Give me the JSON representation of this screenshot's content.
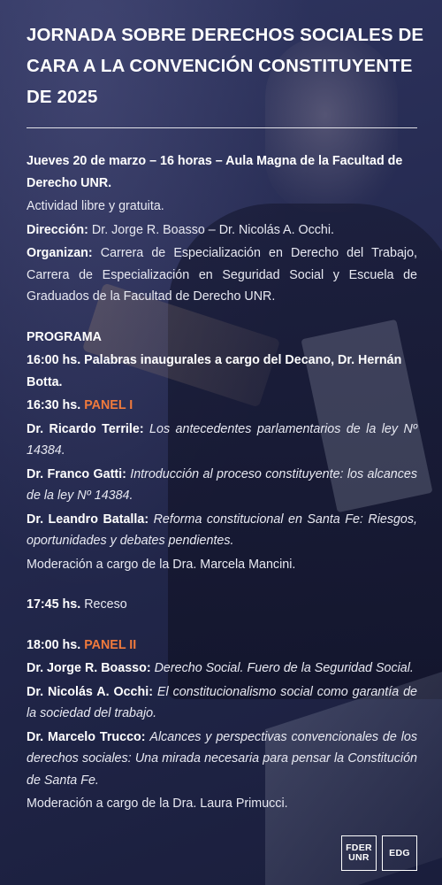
{
  "title": "JORNADA SOBRE DERECHOS SOCIALES DE CARA A LA CONVENCIÓN CONSTITUYENTE DE 2025",
  "header": {
    "when": "Jueves 20 de marzo – 16 horas – Aula Magna de la Facultad de Derecho UNR.",
    "free": "Actividad libre y gratuita.",
    "direction_label": "Dirección:",
    "direction": "Dr. Jorge R. Boasso – Dr. Nicolás A. Occhi.",
    "organizers_label": "Organizan:",
    "organizers": "Carrera de Especialización en Derecho del Trabajo, Carrera de Especialización en Seguridad Social y Escuela de Graduados de la Facultad de Derecho UNR."
  },
  "program": {
    "heading": "PROGRAMA",
    "opening": "16:00 hs. Palabras inaugurales a cargo del Decano, Dr. Hernán Botta.",
    "panel1": {
      "time": "16:30 hs.",
      "name": "PANEL I",
      "talks": [
        {
          "speaker": "Dr. Ricardo Terrile:",
          "topic": "Los antecedentes parlamentarios de la ley Nº 14384."
        },
        {
          "speaker": "Dr. Franco Gatti:",
          "topic": "Introducción al proceso constituyente: los alcances de la ley Nº 14384."
        },
        {
          "speaker": "Dr. Leandro Batalla:",
          "topic": "Reforma constitucional en Santa Fe: Riesgos, oportunidades y debates pendientes."
        }
      ],
      "moderation": "Moderación a cargo de la Dra. Marcela Mancini."
    },
    "break": {
      "time": "17:45 hs.",
      "label": "Receso"
    },
    "panel2": {
      "time": "18:00 hs.",
      "name": "PANEL II",
      "talks": [
        {
          "speaker": "Dr. Jorge R. Boasso:",
          "topic": "Derecho Social. Fuero de la Seguridad Social."
        },
        {
          "speaker": "Dr. Nicolás A. Occhi:",
          "topic": "El constitucionalismo social como garantía de la sociedad del trabajo."
        },
        {
          "speaker": "Dr. Marcelo Trucco:",
          "topic": "Alcances y perspectivas convencionales de los derechos sociales: Una mirada necesaria para pensar la Constitución de Santa Fe."
        }
      ],
      "moderation": "Moderación a cargo de la Dra. Laura Primucci."
    }
  },
  "logos": {
    "fder_line1": "FDER",
    "fder_line2": "UNR",
    "edg": "EDG"
  },
  "colors": {
    "background": "#262b52",
    "accent": "#f07a3c",
    "text": "#ffffff"
  }
}
